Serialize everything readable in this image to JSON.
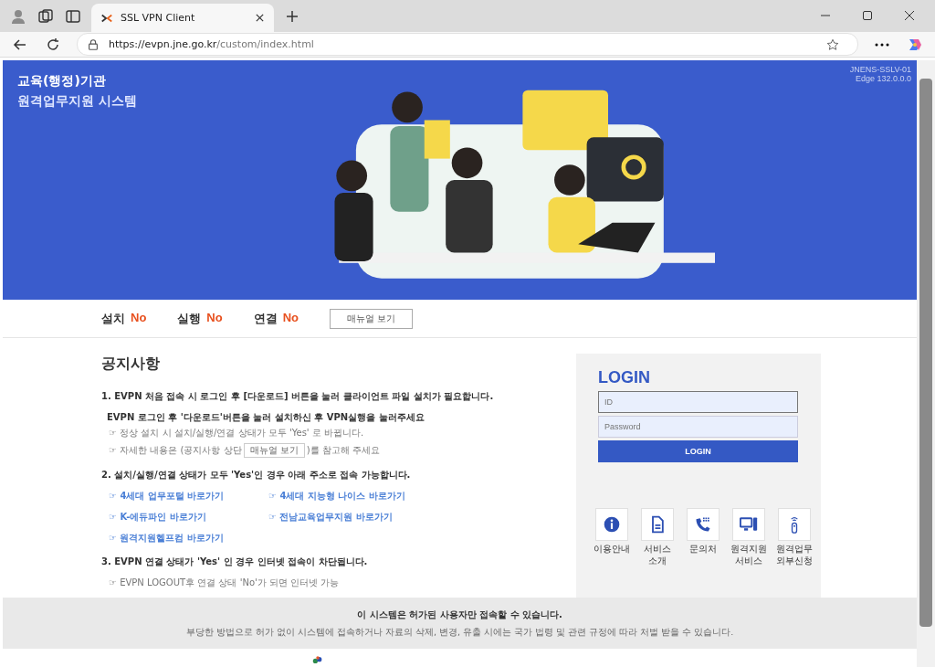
{
  "browser": {
    "tab_title": "SSL VPN Client",
    "url_host": "https://evpn.jne.go.kr",
    "url_path": "/custom/index.html"
  },
  "banner": {
    "title_line1": "교육(행정)기관",
    "title_line2": "원격업무지원 시스템",
    "server": "JNENS-SSLV-01",
    "browser_version": "Edge 132.0.0.0"
  },
  "status": [
    {
      "label": "설치",
      "value": "No"
    },
    {
      "label": "실행",
      "value": "No"
    },
    {
      "label": "연결",
      "value": "No"
    }
  ],
  "manual_button": "매뉴얼 보기",
  "notice": {
    "heading": "공지사항",
    "item1_title": "1. EVPN 처음 접속 시 로그인 후 [다운로드] 버튼을 눌러 클라이언트 파일 설치가 필요합니다.",
    "item1_sub": "EVPN 로그인 후 '다운로드'버튼을 눌러 설치하신 후 VPN실행을 눌러주세요",
    "item1_note1": "☞ 정상 설치 시 설치/실행/연결 상태가 모두 'Yes' 로 바뀝니다.",
    "item1_note2_before": "☞ 자세한 내용은 (공지사항 상단",
    "item1_note2_button": "매뉴얼 보기",
    "item1_note2_after": ")를 참고해 주세요",
    "item2_title": "2. 설치/실행/연결 상태가 모두 'Yes'인 경우 아래 주소로 접속 가능합니다.",
    "links": [
      "☞ 4세대 업무포털 바로가기",
      "☞ 4세대 지능형 나이스 바로가기",
      "☞ K-에듀파인 바로가기",
      "☞ 전남교육업무지원 바로가기",
      "☞ 원격지원헬프컴 바로가기"
    ],
    "item3_title": "3. EVPN 연결 상태가 'Yes' 인 경우 인터넷 접속이 차단됩니다.",
    "item3_note": "☞ EVPN LOGOUT후 연결 상태 'No'가 되면 인터넷 가능"
  },
  "login": {
    "heading": "LOGIN",
    "id_placeholder": "ID",
    "password_placeholder": "Password",
    "button": "LOGIN"
  },
  "quick_links": [
    {
      "kind": "info",
      "label": "이용안내"
    },
    {
      "kind": "document",
      "label": "서비스 소개"
    },
    {
      "kind": "phone",
      "label": "문의처"
    },
    {
      "kind": "computer",
      "label": "원격지원 서비스"
    },
    {
      "kind": "remote",
      "label": "원격업무 외부신청"
    }
  ],
  "footer": {
    "warning": "이 시스템은 허가된 사용자만 접속할 수 있습니다.",
    "notice": "부당한 방법으로 허가 없이 시스템에 접속하거나 자료의 삭제, 변경, 유출 시에는 국가 법령 및 관련 규정에 따라 처벌 받을 수 있습니다."
  }
}
